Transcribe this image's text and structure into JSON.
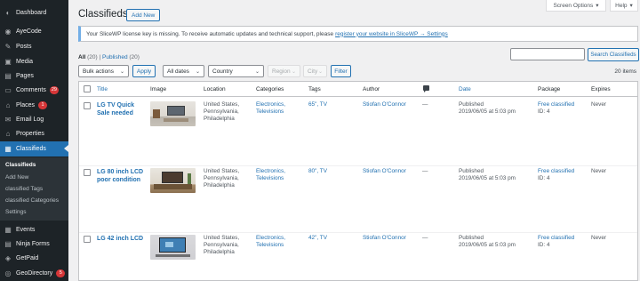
{
  "sidebar": {
    "items": [
      {
        "label": "Dashboard",
        "icon": "dashboard-icon",
        "glyph": "◐"
      },
      {
        "label": "AyeCode",
        "icon": "ayecode-icon",
        "glyph": "◉"
      },
      {
        "label": "Posts",
        "icon": "pin-icon",
        "glyph": "✎"
      },
      {
        "label": "Media",
        "icon": "media-icon",
        "glyph": "▣"
      },
      {
        "label": "Pages",
        "icon": "pages-icon",
        "glyph": "▤"
      },
      {
        "label": "Comments",
        "icon": "comments-icon",
        "glyph": "▭",
        "badge": "29"
      },
      {
        "label": "Places",
        "icon": "places-icon",
        "glyph": "⌂",
        "badge": "1"
      },
      {
        "label": "Email Log",
        "icon": "email-icon",
        "glyph": "✉"
      },
      {
        "label": "Properties",
        "icon": "properties-icon",
        "glyph": "⌂"
      },
      {
        "label": "Classifieds",
        "icon": "classifieds-icon",
        "glyph": "▦",
        "active": true
      }
    ],
    "submenu": [
      "Classifieds",
      "Add New",
      "classified Tags",
      "classified Categories",
      "Settings"
    ],
    "items_bottom": [
      {
        "label": "Events",
        "icon": "events-icon",
        "glyph": "▦"
      },
      {
        "label": "Ninja Forms",
        "icon": "ninja-forms-icon",
        "glyph": "▤"
      },
      {
        "label": "GetPaid",
        "icon": "getpaid-icon",
        "glyph": "◈"
      },
      {
        "label": "GeoDirectory",
        "icon": "geodirectory-icon",
        "glyph": "◎",
        "badge": "5"
      }
    ]
  },
  "top_tabs": {
    "screen_options": "Screen Options",
    "help": "Help"
  },
  "header": {
    "title": "Classifieds",
    "add_new": "Add New"
  },
  "notice": {
    "text": "Your SliceWP license key is missing. To receive automatic updates and technical support, please",
    "link": "register your website in SliceWP → Settings"
  },
  "views": {
    "all": "All",
    "all_count": "(20)",
    "separator": "|",
    "published": "Published",
    "published_count": "(20)"
  },
  "search": {
    "placeholder": "",
    "button": "Search Classifieds"
  },
  "filters": {
    "bulk_actions": "Bulk actions",
    "apply": "Apply",
    "dates": "All dates",
    "country": "Country",
    "region": "Region",
    "city": "City",
    "filter": "Filter",
    "items_count": "20 items"
  },
  "table": {
    "columns": [
      "Title",
      "Image",
      "Location",
      "Categories",
      "Tags",
      "Author",
      "",
      "Date",
      "Package",
      "Expires"
    ],
    "rows": [
      {
        "title_lines": [
          "LG TV Quick",
          "Sale needed"
        ],
        "location_lines": [
          "United States,",
          "Pennsylvania,",
          "Philadelphia"
        ],
        "categories_lines": [
          "Electronics,",
          "Televisions"
        ],
        "tags": "65\", TV",
        "author": "Stiofan O'Connor",
        "comments": "—",
        "date_lines": [
          "Published",
          "2019/06/05 at 5:03 pm"
        ],
        "package_lines": [
          "Free classified",
          "ID: 4"
        ],
        "expires": "Never"
      },
      {
        "title_lines": [
          "LG 80 inch LCD",
          "poor condition"
        ],
        "location_lines": [
          "United States,",
          "Pennsylvania,",
          "Philadelphia"
        ],
        "categories_lines": [
          "Electronics,",
          "Televisions"
        ],
        "tags": "80\", TV",
        "author": "Stiofan O'Connor",
        "comments": "—",
        "date_lines": [
          "Published",
          "2019/06/05 at 5:03 pm"
        ],
        "package_lines": [
          "Free classified",
          "ID: 4"
        ],
        "expires": "Never"
      },
      {
        "title_lines": [
          "LG 42 inch LCD"
        ],
        "location_lines": [
          "United States,",
          "Pennsylvania,",
          "Philadelphia"
        ],
        "categories_lines": [
          "Electronics,",
          "Televisions"
        ],
        "tags": "42\", TV",
        "author": "Stiofan O'Connor",
        "comments": "—",
        "date_lines": [
          "Published",
          "2019/06/05 at 5:03 pm"
        ],
        "package_lines": [
          "Free classified",
          "ID: 4"
        ],
        "expires": "Never"
      }
    ]
  }
}
